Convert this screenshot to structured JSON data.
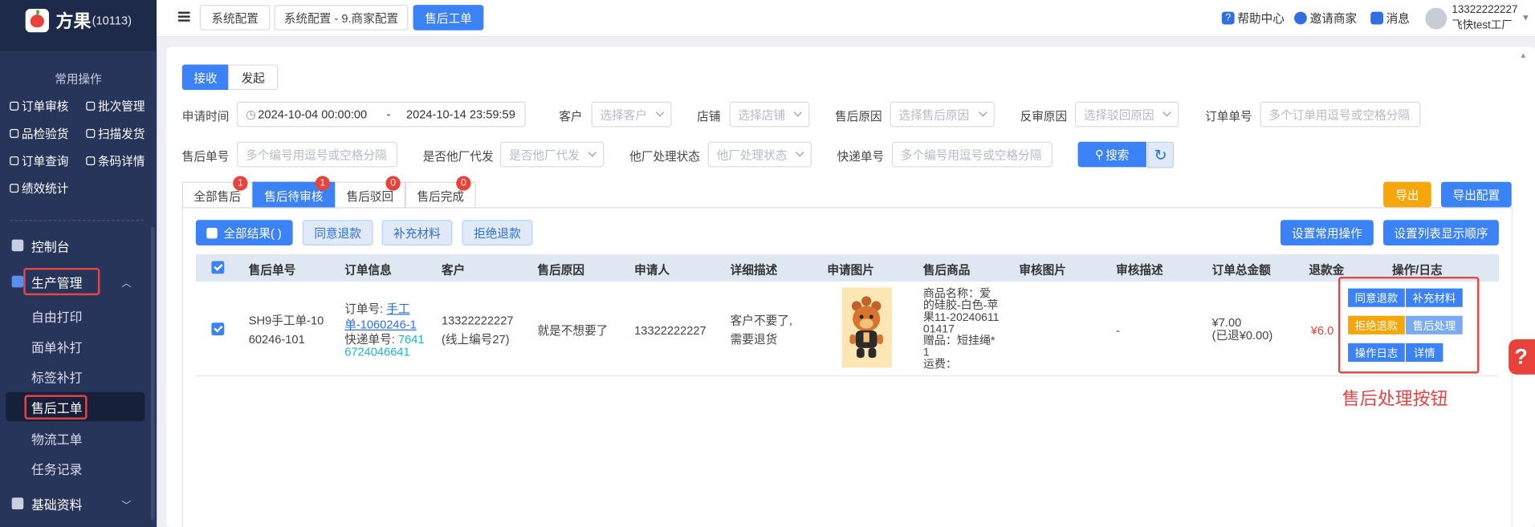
{
  "sidebar": {
    "app_name": "方果",
    "app_id": "(10113)",
    "common_ops_title": "常用操作",
    "common_ops": [
      "订单审核",
      "批次管理",
      "品检验货",
      "扫描发货",
      "订单查询",
      "条码详情",
      "绩效统计"
    ],
    "nav": [
      {
        "label": "控制台"
      },
      {
        "label": "生产管理"
      },
      {
        "label": "自由打印"
      },
      {
        "label": "面单补打"
      },
      {
        "label": "标签补打"
      },
      {
        "label": "售后工单"
      },
      {
        "label": "物流工单"
      },
      {
        "label": "任务记录"
      },
      {
        "label": "基础资料"
      }
    ]
  },
  "topbar": {
    "tabs": [
      "系统配置",
      "系统配置 - 9.商家配置",
      "售后工单"
    ],
    "help": "帮助中心",
    "invite": "邀请商家",
    "message": "消息",
    "user_phone": "13322222227",
    "user_factory": "飞快test工厂"
  },
  "mode_tabs": [
    "接收",
    "发起"
  ],
  "filters": {
    "apply_time_label": "申请时间",
    "date_start": "2024-10-04 00:00:00",
    "date_sep": "-",
    "date_end": "2024-10-14 23:59:59",
    "customer_label": "客户",
    "customer_ph": "选择客户",
    "shop_label": "店铺",
    "shop_ph": "选择店铺",
    "reason_label": "售后原因",
    "reason_ph": "选择售后原因",
    "reject_label": "反审原因",
    "reject_ph": "选择驳回原因",
    "order_no_label": "订单单号",
    "order_no_ph": "多个订单用逗号或空格分隔",
    "aftersale_no_label": "售后单号",
    "aftersale_no_ph": "多个编号用逗号或空格分隔",
    "other_factory_label": "是否他厂代发",
    "other_factory_ph": "是否他厂代发",
    "other_status_label": "他厂处理状态",
    "other_status_ph": "他厂处理状态",
    "express_label": "快递单号",
    "express_ph": "多个编号用逗号或空格分隔",
    "search": "搜索"
  },
  "status_tabs": [
    {
      "label": "全部售后",
      "badge": "1"
    },
    {
      "label": "售后待审核",
      "badge": "1"
    },
    {
      "label": "售后驳回",
      "badge": "0"
    },
    {
      "label": "售后完成",
      "badge": "0"
    }
  ],
  "actions": {
    "export": "导出",
    "export_config": "导出配置",
    "select_all": "全部结果( )",
    "agree": "同意退款",
    "supplement": "补充材料",
    "reject": "拒绝退款",
    "set_common": "设置常用操作",
    "set_columns": "设置列表显示顺序"
  },
  "table": {
    "headers": [
      "售后单号",
      "订单信息",
      "客户",
      "售后原因",
      "申请人",
      "详细描述",
      "申请图片",
      "售后商品",
      "审核图片",
      "审核描述",
      "订单总金额",
      "退款金",
      "操作/日志"
    ],
    "row": {
      "aftersale_no_1": "SH9手工单-10",
      "aftersale_no_2": "60246-101",
      "order_label": "订单号:",
      "order_link_1": "手工",
      "order_link_2": "单-1060246-1",
      "express_label": "快递单号:",
      "express_1": "7641",
      "express_2": "6724046641",
      "customer_1": "13322222227",
      "customer_2": "(线上编号27)",
      "reason": "就是不想要了",
      "applicant": "13322222227",
      "desc_1": "客户不要了,",
      "desc_2": "需要退货",
      "goods_1": "商品名称：爱",
      "goods_2": "的硅胶-白色-苹",
      "goods_3": "果11-20240611",
      "goods_4": "01417",
      "goods_5": "赠品：短挂绳*",
      "goods_6": "1",
      "goods_7": "运费：",
      "audit_desc": "-",
      "total_1": "¥7.00",
      "total_2": "(已退¥0.00)",
      "refund": "¥6.0"
    },
    "op_buttons": [
      "同意退款",
      "补充材料",
      "拒绝退款",
      "售后处理",
      "操作日志",
      "详情"
    ]
  },
  "annotation": "售后处理按钮",
  "colors": {
    "sidebar": "#1e2a4a",
    "primary": "#3b82f6",
    "orange": "#f5a60a",
    "danger": "#e8423a"
  }
}
